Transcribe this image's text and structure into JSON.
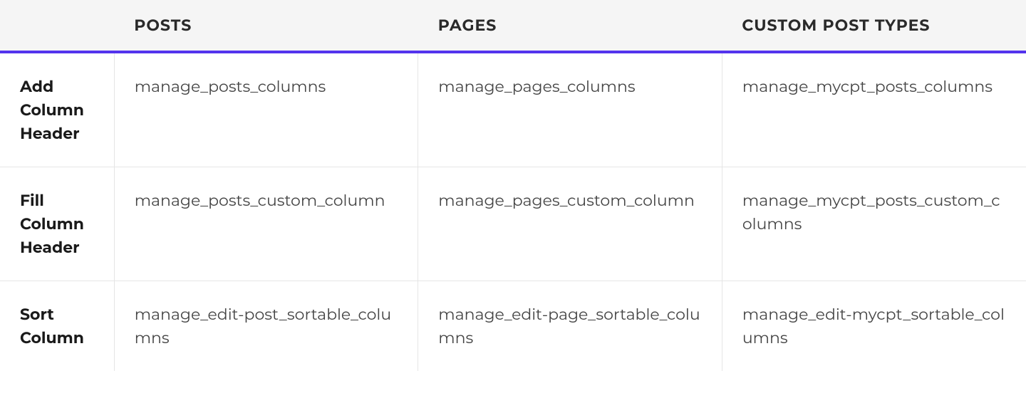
{
  "table": {
    "columns": [
      "POSTS",
      "PAGES",
      "CUSTOM POST TYPES"
    ],
    "rows": [
      {
        "header": "Add Column Header",
        "posts": "manage_posts_columns",
        "pages": "manage_pages_columns",
        "cpt": "manage_mycpt_posts_columns"
      },
      {
        "header": "Fill Column Header",
        "posts": "manage_posts_custom_column",
        "pages": "manage_pages_custom_column",
        "cpt": "manage_mycpt_posts_custom_columns"
      },
      {
        "header": "Sort Column",
        "posts": "manage_edit-post_sortable_columns",
        "pages": "manage_edit-page_sortable_columns",
        "cpt": "manage_edit-mycpt_sortable_columns"
      }
    ]
  }
}
